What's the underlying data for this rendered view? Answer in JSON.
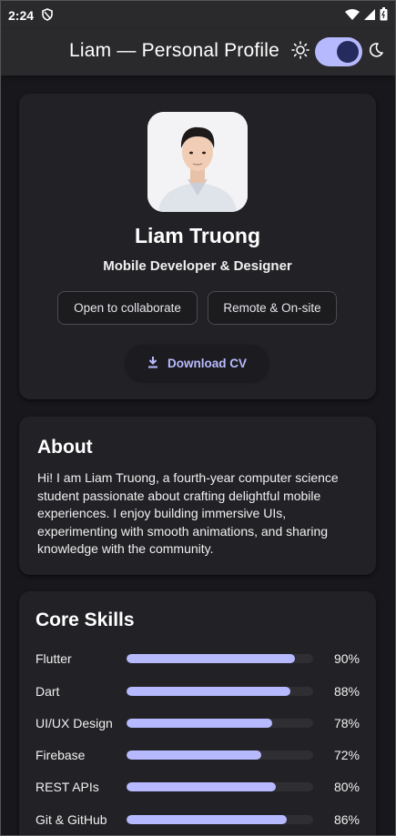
{
  "status_bar": {
    "time": "2:24"
  },
  "app_bar": {
    "title": "Liam — Personal Profile",
    "dark_mode": true
  },
  "profile": {
    "name": "Liam Truong",
    "role": "Mobile Developer & Designer",
    "chips": [
      "Open to collaborate",
      "Remote & On-site"
    ],
    "download_label": "Download CV"
  },
  "about": {
    "title": "About",
    "text": "Hi! I am Liam Truong, a fourth-year computer science student passionate about crafting delightful mobile experiences. I enjoy building immersive UIs, experimenting with smooth animations, and sharing knowledge with the community."
  },
  "skills": {
    "title": "Core Skills",
    "items": [
      {
        "name": "Flutter",
        "level": 0.9,
        "pct": "90%"
      },
      {
        "name": "Dart",
        "level": 0.88,
        "pct": "88%"
      },
      {
        "name": "UI/UX Design",
        "level": 0.78,
        "pct": "78%"
      },
      {
        "name": "Firebase",
        "level": 0.72,
        "pct": "72%"
      },
      {
        "name": "REST APIs",
        "level": 0.8,
        "pct": "80%"
      },
      {
        "name": "Git & GitHub",
        "level": 0.86,
        "pct": "86%"
      }
    ]
  },
  "colors": {
    "accent": "#b7b9ff",
    "background": "#18181c",
    "card": "#222226"
  }
}
